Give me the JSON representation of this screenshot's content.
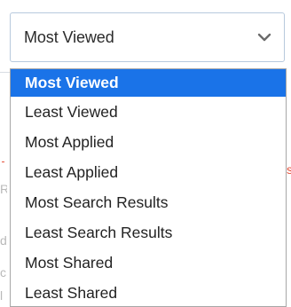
{
  "sort_select": {
    "selected_value": "Most Viewed",
    "icon": "chevron-down-icon",
    "options": [
      "Most Viewed",
      "Least Viewed",
      "Most Applied",
      "Least Applied",
      "Most Search Results",
      "Least Search Results",
      "Most Shared",
      "Least Shared"
    ],
    "selected_index": 0
  },
  "colors": {
    "highlight": "#1a73e8",
    "highlight_text": "#ffffff",
    "border": "#b7c9dd",
    "text": "#222222"
  }
}
